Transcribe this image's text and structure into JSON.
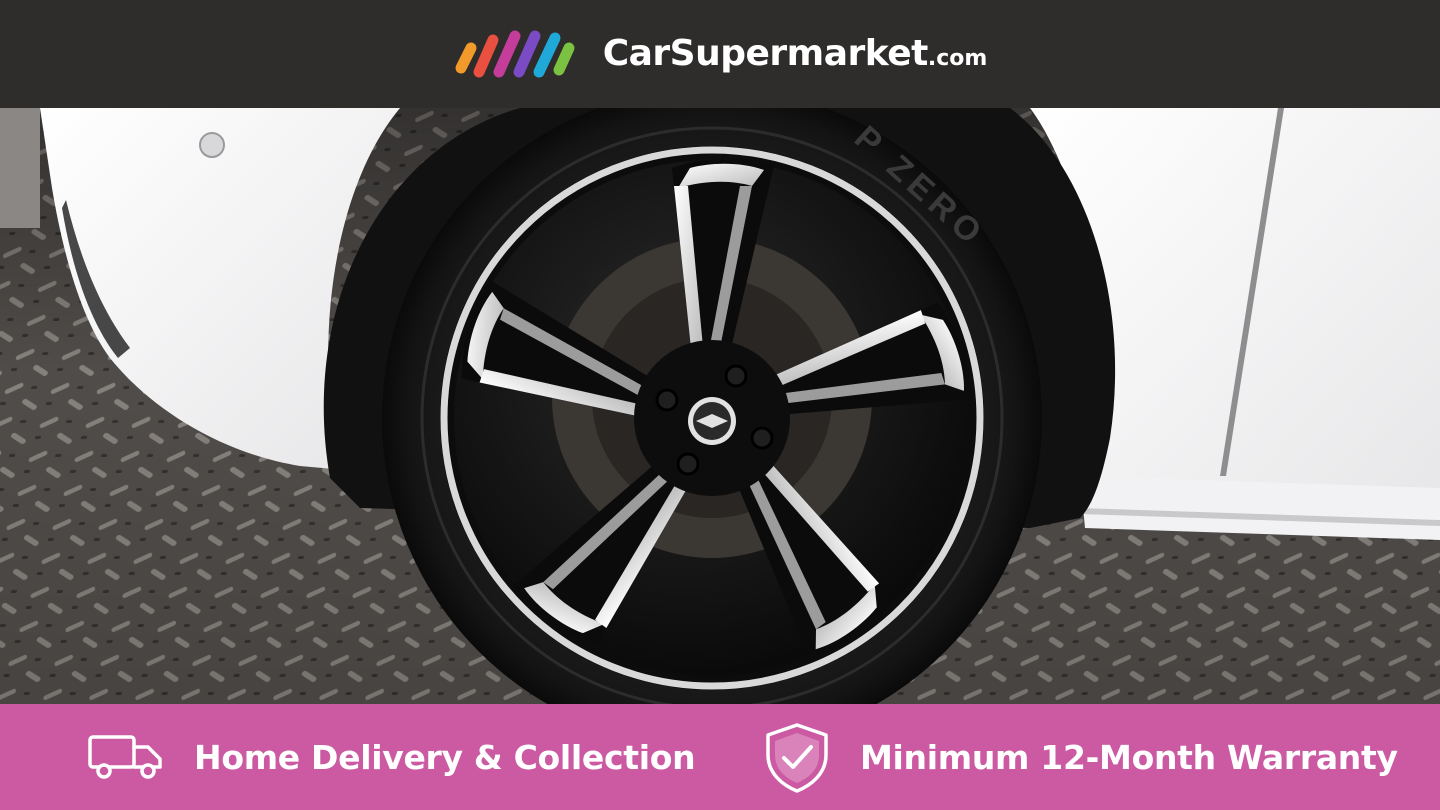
{
  "header": {
    "brand_name": "CarSupermarket",
    "brand_tld": ".com",
    "logo_icon": "rainbow-stripes-logo-icon",
    "background": "#2f2d2c"
  },
  "photo": {
    "subject": "car-wheel-photo",
    "tyre_sidewall_text": "P ZERO"
  },
  "footer": {
    "background": "#cc5aa3",
    "features": [
      {
        "icon": "delivery-truck-icon",
        "label": "Home Delivery & Collection"
      },
      {
        "icon": "shield-check-icon",
        "label": "Minimum 12-Month Warranty"
      }
    ]
  }
}
